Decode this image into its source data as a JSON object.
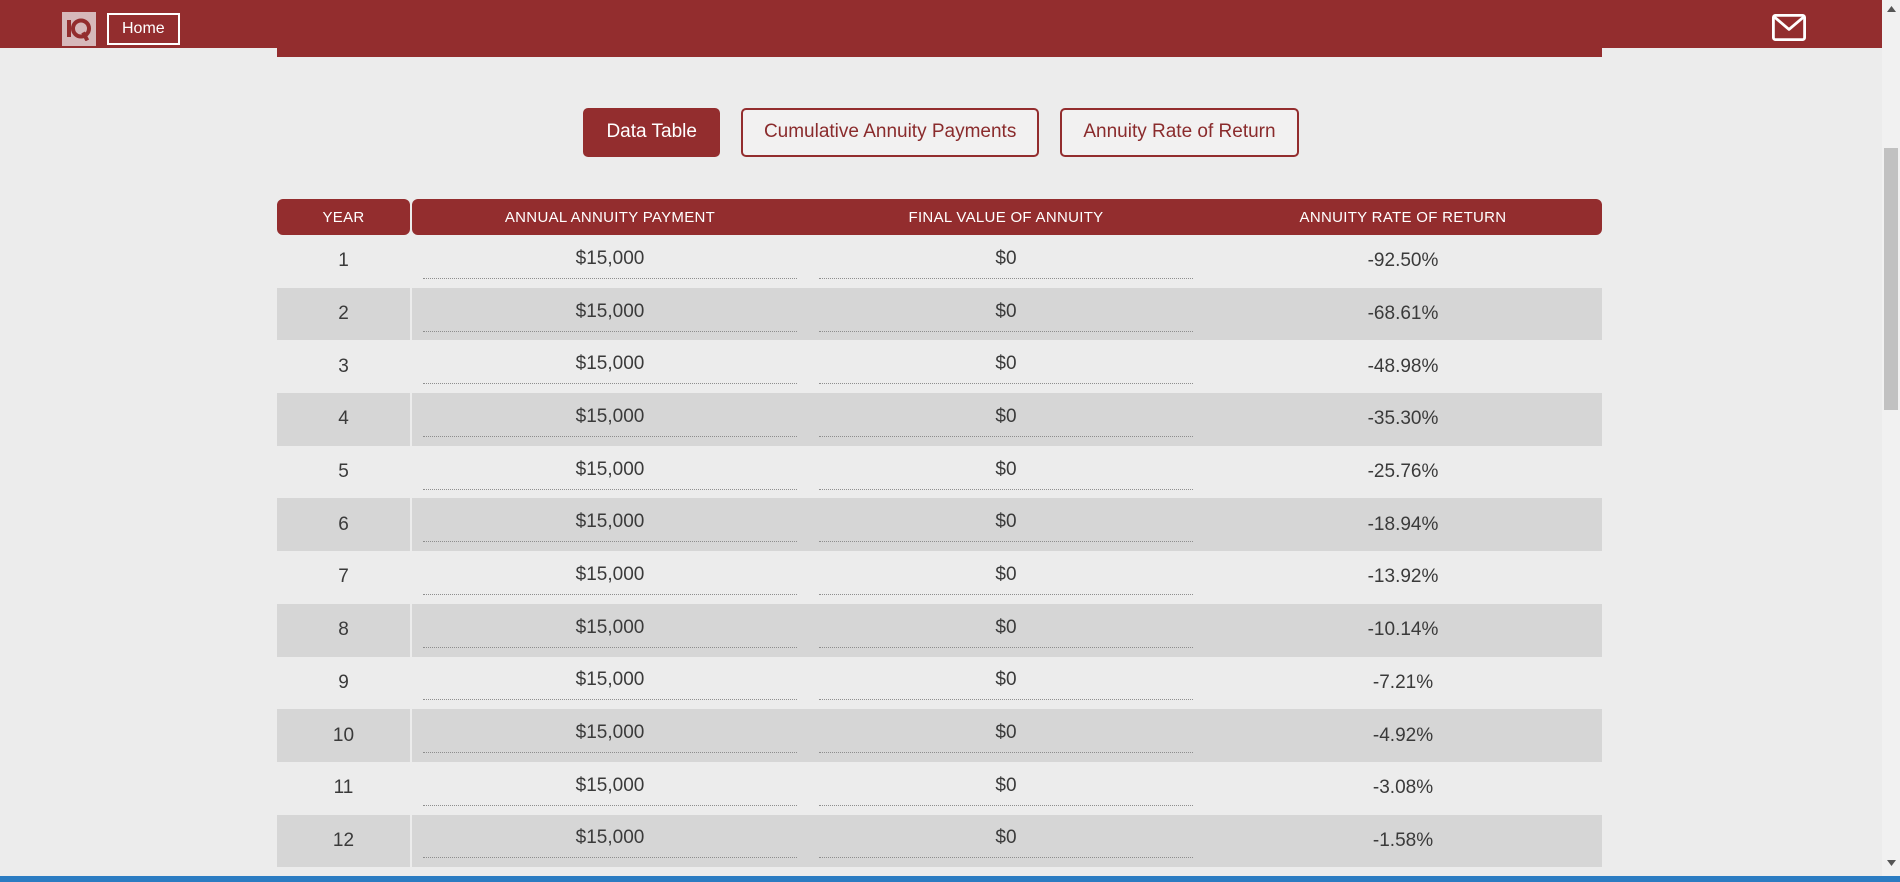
{
  "colors": {
    "brand_red": "#932d2e",
    "page_bg": "#ececec",
    "row_alt_bg": "#d6d6d6",
    "logo_bg": "#d6b8ba",
    "bottom_bar_blue": "#2b7cc2",
    "scrollbar_thumb": "#c1c1c1"
  },
  "topbar": {
    "logo_text": "IQ",
    "logo_icon": "iq-logo-icon",
    "home_label": "Home",
    "mail_icon": "envelope-icon"
  },
  "tabs": [
    {
      "label": "Data Table",
      "active": true
    },
    {
      "label": "Cumulative Annuity Payments",
      "active": false
    },
    {
      "label": "Annuity Rate of Return",
      "active": false
    }
  ],
  "table": {
    "headers": [
      "YEAR",
      "ANNUAL ANNUITY PAYMENT",
      "FINAL VALUE OF ANNUITY",
      "ANNUITY RATE OF RETURN"
    ],
    "rows": [
      {
        "year": "1",
        "annual_payment": "$15,000",
        "final_value": "$0",
        "rate_of_return": "-92.50%"
      },
      {
        "year": "2",
        "annual_payment": "$15,000",
        "final_value": "$0",
        "rate_of_return": "-68.61%"
      },
      {
        "year": "3",
        "annual_payment": "$15,000",
        "final_value": "$0",
        "rate_of_return": "-48.98%"
      },
      {
        "year": "4",
        "annual_payment": "$15,000",
        "final_value": "$0",
        "rate_of_return": "-35.30%"
      },
      {
        "year": "5",
        "annual_payment": "$15,000",
        "final_value": "$0",
        "rate_of_return": "-25.76%"
      },
      {
        "year": "6",
        "annual_payment": "$15,000",
        "final_value": "$0",
        "rate_of_return": "-18.94%"
      },
      {
        "year": "7",
        "annual_payment": "$15,000",
        "final_value": "$0",
        "rate_of_return": "-13.92%"
      },
      {
        "year": "8",
        "annual_payment": "$15,000",
        "final_value": "$0",
        "rate_of_return": "-10.14%"
      },
      {
        "year": "9",
        "annual_payment": "$15,000",
        "final_value": "$0",
        "rate_of_return": "-7.21%"
      },
      {
        "year": "10",
        "annual_payment": "$15,000",
        "final_value": "$0",
        "rate_of_return": "-4.92%"
      },
      {
        "year": "11",
        "annual_payment": "$15,000",
        "final_value": "$0",
        "rate_of_return": "-3.08%"
      },
      {
        "year": "12",
        "annual_payment": "$15,000",
        "final_value": "$0",
        "rate_of_return": "-1.58%"
      }
    ]
  },
  "scrollbar": {
    "up_arrow_icon": "chevron-up-icon",
    "down_arrow_icon": "chevron-down-icon"
  }
}
